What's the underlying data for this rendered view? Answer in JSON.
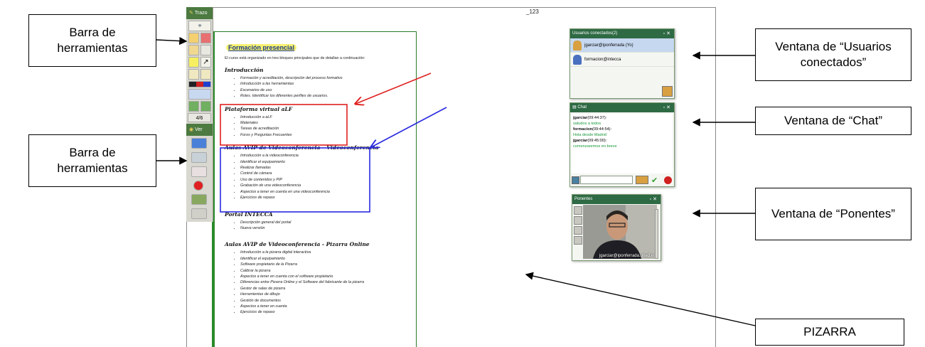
{
  "callouts": {
    "toolbar_top": "Barra de herramientas",
    "toolbar_bottom": "Barra de herramientas",
    "users": "Ventana de “Usuarios conectados”",
    "chat": "Ventana de “Chat”",
    "speakers": "Ventana de “Ponentes”",
    "whiteboard": "PIZARRA"
  },
  "toolbar": {
    "section_trazo": "Trazo",
    "section_ver": "Ver",
    "page_indicator": "4/6"
  },
  "board": {
    "page_number": "_123"
  },
  "slide": {
    "title": "Formación presencial",
    "intro": "El curso está organizado en tres bloques principales que de detallan a continuación:",
    "sections": [
      {
        "heading": "Introducción",
        "items": [
          "Formación y acreditación, descripción del proceso formativo",
          "Introducción a las herramientas",
          "Escenarios de uso",
          "Roles. Identificar los diferentes perfiles de usuarios."
        ]
      },
      {
        "heading": "Plataforma virtual aLF",
        "items": [
          "Introducción a aLF",
          "Materiales",
          "Tareas de acreditación",
          "Foros y Preguntas Frecuentes"
        ]
      },
      {
        "heading": "Aulas AVIP de Videoconferencia – Videoconferencia",
        "items": [
          "Introducción a la videoconferencia",
          "Identificar el equipamiento",
          "Realizar llamadas",
          "Control de cámara",
          "Uso de contenidos y PIP",
          "Grabación de una videoconferencia",
          "Aspectos a tener en cuenta en una videoconferencia",
          "Ejercicios de repaso"
        ]
      },
      {
        "heading": "Portal INTECCA",
        "items": [
          "Descripción general del portal",
          "Nueva versión"
        ]
      },
      {
        "heading": "Aulas AVIP de Videoconferencia - Pizarra Online",
        "items": [
          "Introducción a la pizarra digital interactiva",
          "Identificar el equipamiento",
          "Software propietario de la Pizarra",
          "Calibrar la pizarra",
          "Aspectos a tener en cuenta con el software propietario",
          "Diferencias entre Pizarra Online y el Software del fabricante de la pizarra",
          "Gestor de salas de pizarra",
          "Herramientas de dibujo",
          "Gestión de documentos",
          "Aspectos a tener en cuenta",
          "Ejercicios de repaso"
        ]
      }
    ]
  },
  "users_window": {
    "title": "Usuarios conectados(2)",
    "users": [
      "jgarciar@iponferrada (Yo)",
      "formacion@intecca"
    ]
  },
  "chat_window": {
    "title": "Chat",
    "messages": [
      {
        "who": "jgarciar",
        "time": "(09:44:37):",
        "text": "saludos a todos"
      },
      {
        "who": "formacion",
        "time": "(09:44:54):",
        "text": "Hola desde Madrid"
      },
      {
        "who": "jgarciar",
        "time": "(09:45:00):",
        "text": "comenzaremos en breve"
      }
    ]
  },
  "speakers_window": {
    "title": "Ponentes",
    "camera_label": "jgarciar@iponferrada.uned.es"
  },
  "colors": {
    "window_title": "#2e6a44",
    "annotation_red": "#e02020",
    "annotation_blue": "#2a2ae0",
    "slide_border": "#2a8a2a"
  }
}
